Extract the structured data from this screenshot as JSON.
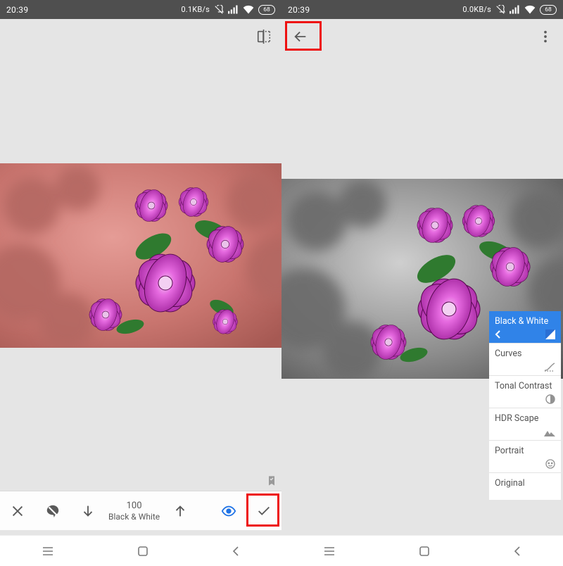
{
  "statusbar": {
    "time": "20:39",
    "left_net": "0.1KB/s",
    "right_net": "0.0KB/s",
    "battery": "68"
  },
  "left": {
    "toolbar": {
      "compare_icon": true
    },
    "adjust": {
      "value": "100",
      "label": "Black & White"
    }
  },
  "right": {
    "toolbar": {
      "back_icon": true,
      "overflow_icon": true
    },
    "fx": {
      "items": [
        {
          "label": "Black & White",
          "icon": "contrast-square",
          "active": true
        },
        {
          "label": "Curves",
          "icon": "curves"
        },
        {
          "label": "Tonal Contrast",
          "icon": "half-circle"
        },
        {
          "label": "HDR Scape",
          "icon": "mountains"
        },
        {
          "label": "Portrait",
          "icon": "face"
        },
        {
          "label": "Original",
          "icon": ""
        }
      ]
    }
  }
}
